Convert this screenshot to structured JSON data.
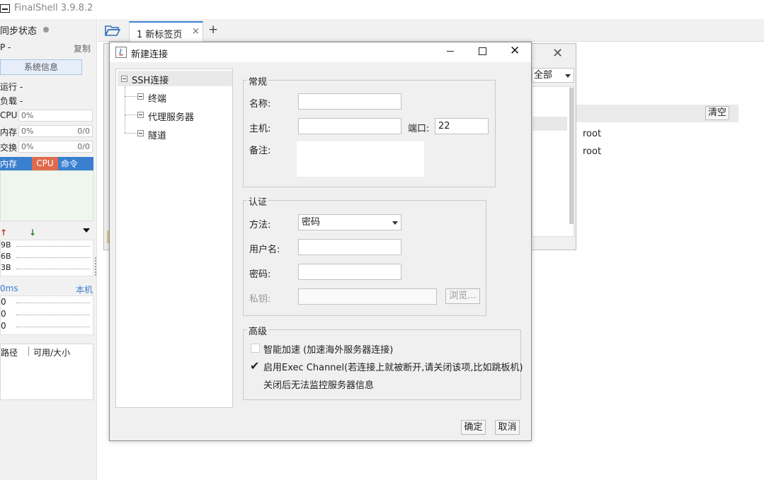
{
  "app": {
    "title": "FinalShell 3.9.8.2"
  },
  "sidebar": {
    "sync_label": "同步状态",
    "ip_label": "P  -",
    "copy_label": "复制",
    "sysinfo_button": "系统信息",
    "uptime_label": "运行 -",
    "load_label": "负载 -",
    "cpu": {
      "label": "CPU",
      "value": "0%"
    },
    "mem": {
      "label": "内存",
      "value": "0%",
      "extra": "0/0"
    },
    "swap": {
      "label": "交换",
      "value": "0%",
      "extra": "0/0"
    },
    "proc_tabs": [
      "内存",
      "CPU",
      "命令"
    ],
    "net_values": [
      "9B",
      "6B",
      "3B"
    ],
    "latency": {
      "label": "0ms",
      "right": "本机",
      "values": [
        "0",
        "0",
        "0"
      ]
    },
    "disk_headers": [
      "路径",
      "可用/大小"
    ]
  },
  "tabs": {
    "items": [
      {
        "label": "1 新标签页"
      }
    ]
  },
  "bg_dialog": {
    "filter_value": "全部",
    "clear_label": "清空",
    "rows": [
      "root",
      "root"
    ]
  },
  "dialog": {
    "title": "新建连接",
    "tree": {
      "root": "SSH连接",
      "children": [
        "终端",
        "代理服务器",
        "隧道"
      ]
    },
    "general": {
      "legend": "常规",
      "name_label": "名称:",
      "name_value": "",
      "host_label": "主机:",
      "host_value": "",
      "port_label": "端口:",
      "port_value": "22",
      "note_label": "备注:"
    },
    "auth": {
      "legend": "认证",
      "method_label": "方法:",
      "method_value": "密码",
      "user_label": "用户名:",
      "password_label": "密码:",
      "key_label": "私钥:",
      "browse_label": "浏览..."
    },
    "advanced": {
      "legend": "高级",
      "smart_accel": {
        "label": "智能加速 (加速海外服务器连接)",
        "checked": false
      },
      "exec_channel": {
        "label": "启用Exec Channel(若连接上就被断开,请关闭该项,比如跳板机)",
        "checked": true
      },
      "exec_note": "关闭后无法监控服务器信息"
    },
    "ok_label": "确定",
    "cancel_label": "取消"
  },
  "colors": {
    "accent_blue": "#3a7fd0",
    "cpu_red": "#e06a4d",
    "chart_bg": "#eef6ee"
  }
}
